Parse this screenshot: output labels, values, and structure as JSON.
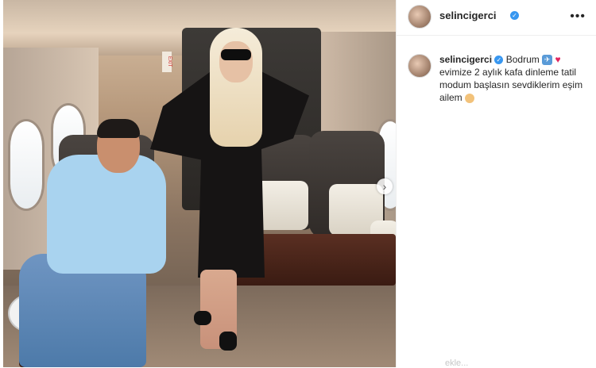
{
  "post": {
    "username": "selincigerci",
    "caption": {
      "part1": "Bodrum",
      "part2": "evimize 2 aylık kafa dinleme tatil modum başlasın sevdiklerim eşim ailem"
    },
    "bottom_hint": "ekle..."
  },
  "photo": {
    "next_button_glyph": "›",
    "sign_text": "EXIT"
  },
  "header": {
    "more_glyph": "•••"
  },
  "icons": {
    "verified": "verified-badge-icon",
    "plane": "airplane-emoji-icon",
    "heart": "red-heart-emoji-icon",
    "hands": "hands-emoji-icon"
  },
  "colors": {
    "verified": "#3897f0",
    "heart": "#e0245e",
    "text": "#262626"
  }
}
